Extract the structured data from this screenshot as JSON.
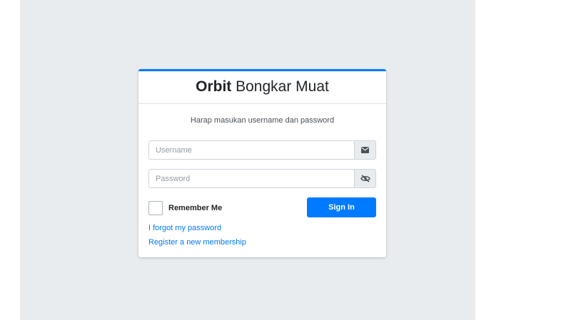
{
  "header": {
    "brand_bold": "Orbit",
    "brand_rest": "Bongkar Muat"
  },
  "form": {
    "message": "Harap masukan username dan password",
    "username": {
      "value": "",
      "placeholder": "Username",
      "icon": "envelope-icon"
    },
    "password": {
      "value": "",
      "placeholder": "Password",
      "icon": "eye-slash-icon"
    },
    "remember_label": "Remember Me",
    "remember_checked": false,
    "submit_label": "Sign In"
  },
  "links": {
    "forgot": "I forgot my password",
    "register": "Register a new membership"
  },
  "colors": {
    "primary": "#007bff",
    "background": "#e9ecef"
  }
}
